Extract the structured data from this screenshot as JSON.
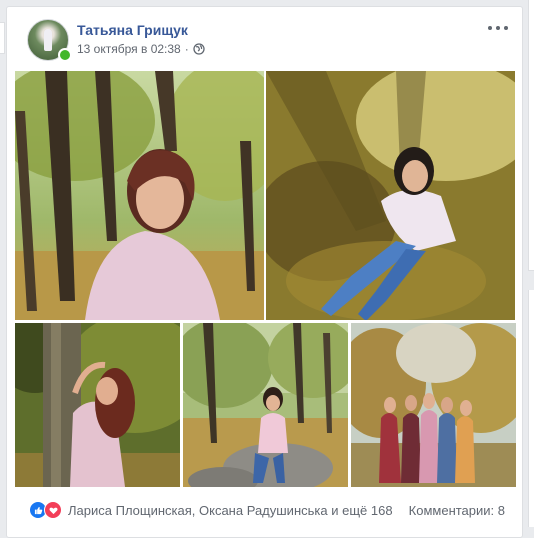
{
  "post": {
    "author": "Татьяна Грищук",
    "timestamp": "13 октября в 02:38",
    "separator": "·",
    "privacy_icon": "globe-icon",
    "more_icon": "more-options-icon",
    "photos": [
      {
        "name": "photo-woman-portrait-trees"
      },
      {
        "name": "photo-woman-lying-leaves"
      },
      {
        "name": "photo-woman-by-tree"
      },
      {
        "name": "photo-woman-sitting-rock"
      },
      {
        "name": "photo-group-of-women"
      }
    ],
    "reactions": {
      "icons": [
        "like-icon",
        "love-icon"
      ],
      "likers": "Лариса Площинская, Оксана Радушинська и ещё 168"
    },
    "comments": "Комментарии: 8"
  },
  "colors": {
    "author": "#385898",
    "meta": "#616770",
    "like": "#1877f2",
    "love": "#f33e58",
    "online": "#42b72a"
  }
}
